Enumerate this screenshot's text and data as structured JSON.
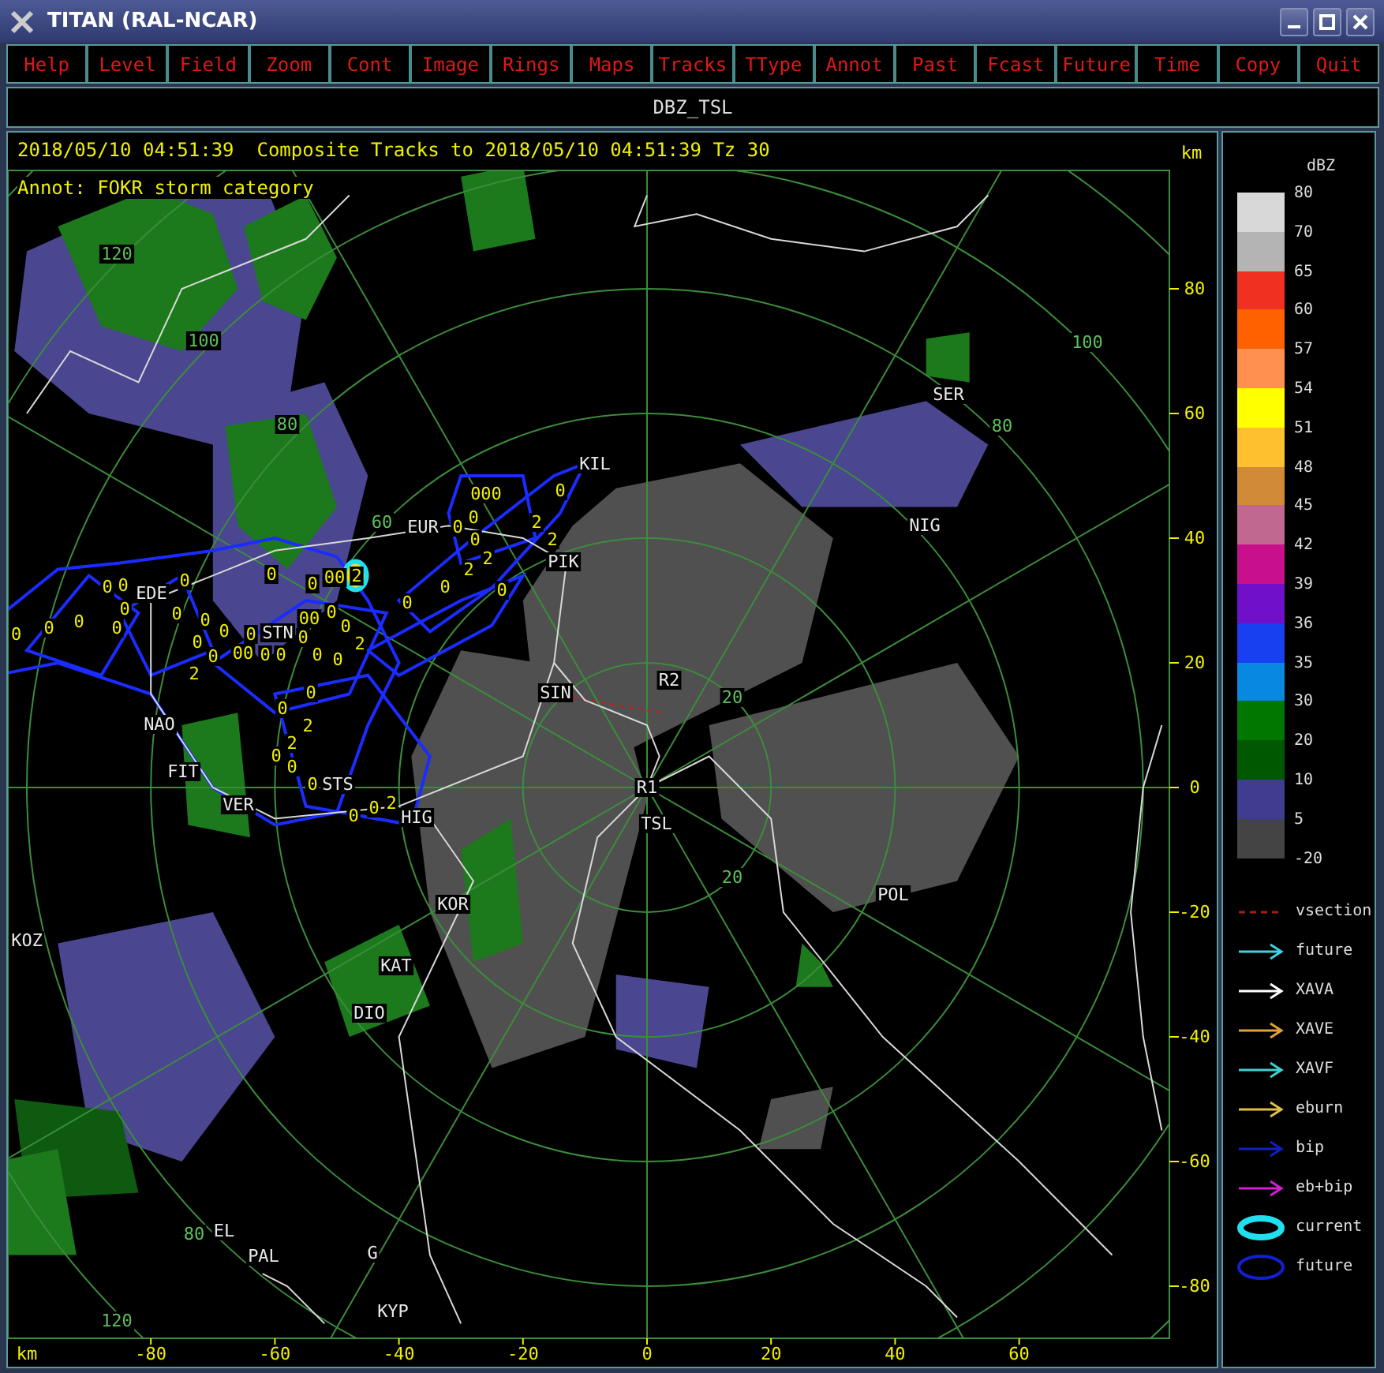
{
  "window": {
    "title": "TITAN (RAL-NCAR)"
  },
  "menu": [
    "Help",
    "Level",
    "Field",
    "Zoom",
    "Cont",
    "Image",
    "Rings",
    "Maps",
    "Tracks",
    "TType",
    "Annot",
    "Past",
    "Fcast",
    "Future",
    "Time",
    "Copy",
    "Quit"
  ],
  "field_title": "DBZ_TSL",
  "display": {
    "header": "2018/05/10 04:51:39  Composite Tracks to 2018/05/10 04:51:39 Tz 30",
    "units_top": "km",
    "annotation": "Annot: FOKR storm category",
    "units_bottom": "km",
    "x_ticks": [
      "-80",
      "-60",
      "-40",
      "-20",
      "0",
      "20",
      "40",
      "60"
    ],
    "y_ticks": [
      "80",
      "60",
      "40",
      "20",
      "0",
      "-20",
      "-40",
      "-60",
      "-80"
    ],
    "ring_labels": [
      "120",
      "100",
      "80",
      "60",
      "100",
      "80",
      "20",
      "20",
      "80",
      "120"
    ],
    "stations": [
      {
        "name": "KIL"
      },
      {
        "name": "EUR"
      },
      {
        "name": "PIK"
      },
      {
        "name": "EDE"
      },
      {
        "name": "STN"
      },
      {
        "name": "NAO"
      },
      {
        "name": "FIT"
      },
      {
        "name": "VER"
      },
      {
        "name": "STS"
      },
      {
        "name": "HIG"
      },
      {
        "name": "SIN"
      },
      {
        "name": "R2"
      },
      {
        "name": "R1"
      },
      {
        "name": "TSL"
      },
      {
        "name": "SER"
      },
      {
        "name": "NIG"
      },
      {
        "name": "POL"
      },
      {
        "name": "KOZ"
      },
      {
        "name": "KOR"
      },
      {
        "name": "KAT"
      },
      {
        "name": "DIO"
      },
      {
        "name": "EL"
      },
      {
        "name": "PAL"
      },
      {
        "name": "G"
      },
      {
        "name": "KYP"
      }
    ],
    "storm_labels": [
      "000",
      "0",
      "0",
      "0",
      "2",
      "0",
      "2",
      "2",
      "0",
      "00",
      "2",
      "2",
      "0",
      "0",
      "0",
      "0",
      "0",
      "0",
      "0",
      "0",
      "0",
      "0",
      "0",
      "00",
      "0",
      "0",
      "0",
      "0",
      "0",
      "0",
      "0",
      "0",
      "00",
      "0",
      "2",
      "0",
      "0",
      "0",
      "0",
      "0",
      "2",
      "0",
      "0",
      "2",
      "2",
      "0",
      "0",
      "0",
      "0",
      "0",
      "2"
    ]
  },
  "legend": {
    "title": "dBZ",
    "labels": [
      "80",
      "70",
      "65",
      "60",
      "57",
      "54",
      "51",
      "48",
      "45",
      "42",
      "39",
      "36",
      "35",
      "30",
      "20",
      "10",
      "5",
      "-20"
    ],
    "blocks": [
      {
        "color": "#d8d8d8"
      },
      {
        "color": "#b4b4b4"
      },
      {
        "color": "#f03020"
      },
      {
        "color": "#ff6000"
      },
      {
        "color": "#ff9050"
      },
      {
        "color": "#ffff00"
      },
      {
        "color": "#ffc030"
      },
      {
        "color": "#d08a38"
      },
      {
        "color": "#c06890"
      },
      {
        "color": "#c8108c"
      },
      {
        "color": "#7010c8"
      },
      {
        "color": "#1840f0"
      },
      {
        "color": "#0888e0"
      },
      {
        "color": "#007800"
      },
      {
        "color": "#005800"
      },
      {
        "color": "#403c90"
      },
      {
        "color": "#444444"
      }
    ],
    "symbols": [
      {
        "kind": "dashed",
        "label": "vsection",
        "color": "#a02020"
      },
      {
        "kind": "arrow",
        "label": "future",
        "color": "#40d0e0"
      },
      {
        "kind": "arrow",
        "label": "XAVA",
        "color": "#ffffff"
      },
      {
        "kind": "arrow",
        "label": "XAVE",
        "color": "#e0a040"
      },
      {
        "kind": "arrow",
        "label": "XAVF",
        "color": "#40d0d0"
      },
      {
        "kind": "arrow",
        "label": "eburn",
        "color": "#e0c040"
      },
      {
        "kind": "arrow",
        "label": "bip",
        "color": "#1020c0"
      },
      {
        "kind": "arrow",
        "label": "eb+bip",
        "color": "#d020d0"
      },
      {
        "kind": "ellipse",
        "label": "current",
        "color": "#20e0f0"
      },
      {
        "kind": "ellipse",
        "label": "future",
        "color": "#1020d0"
      }
    ]
  }
}
